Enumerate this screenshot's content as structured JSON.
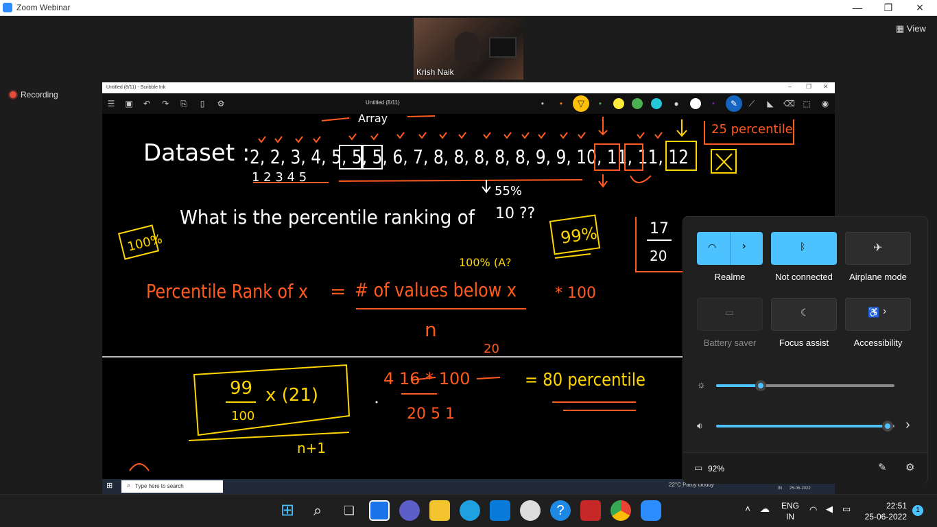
{
  "window": {
    "title": "Zoom Webinar",
    "minimize": "—",
    "maximize": "❐",
    "close": "✕"
  },
  "speaker": {
    "name": "Krish Naik"
  },
  "view_button": "View",
  "recording": "Recording",
  "ink": {
    "window_title": "Untitled (8/11) - Scribble Ink",
    "doc_title": "Untitled (8/11)",
    "swatch_colors": [
      "#ffeb3b",
      "#4caf50",
      "#26c6da",
      "#ffffff",
      "#ffffff"
    ]
  },
  "whiteboard": {
    "heading": "Dataset :",
    "dataset": "2, 2, 3, 4, 5, 5, 5, 6, 7, 8, 8, 8, 8, 8, 9, 9, 10, 11, 11, 12",
    "indices": "1  2  3 4   5",
    "percent_55": "55%",
    "ten_below": "10",
    "question": "What is the percentile ranking of",
    "question_value": "10 ??",
    "hundred_pct": "100%",
    "ninetynine_pct": "99%",
    "percentile_25": "25 percentile",
    "fraction_17": "17",
    "fraction_20": "20",
    "formula_left": "Percentile Rank of x",
    "formula_equals": "=",
    "formula_numerator": "# of values below x",
    "formula_denominator": "n",
    "formula_times": "* 100",
    "small_100pct": "100% (A?",
    "twenty": "20",
    "box_numerator": "99",
    "box_denominator": "100",
    "box_times": "x (21)",
    "n_plus_1": "n+1",
    "calc": "4  16  * 100",
    "calc_den": "20 5 1",
    "calc_result": "=  80 percentile"
  },
  "inner_taskbar": {
    "search_placeholder": "Type here to search",
    "weather": "22°C  Partly cloudy",
    "lang": "IN",
    "date": "25-06-2022"
  },
  "quick_settings": {
    "tiles": [
      {
        "label": "Realme",
        "active": true
      },
      {
        "label": "Not connected",
        "active": true
      },
      {
        "label": "Airplane mode",
        "active": false
      },
      {
        "label": "Battery saver",
        "active": false,
        "disabled": true
      },
      {
        "label": "Focus assist",
        "active": false
      },
      {
        "label": "Accessibility",
        "active": false
      }
    ],
    "brightness": 0.25,
    "volume": 0.96,
    "battery": "92%"
  },
  "taskbar": {
    "lang_line1": "ENG",
    "lang_line2": "IN",
    "time": "22:51",
    "date": "25-06-2022",
    "notifications": "1"
  }
}
